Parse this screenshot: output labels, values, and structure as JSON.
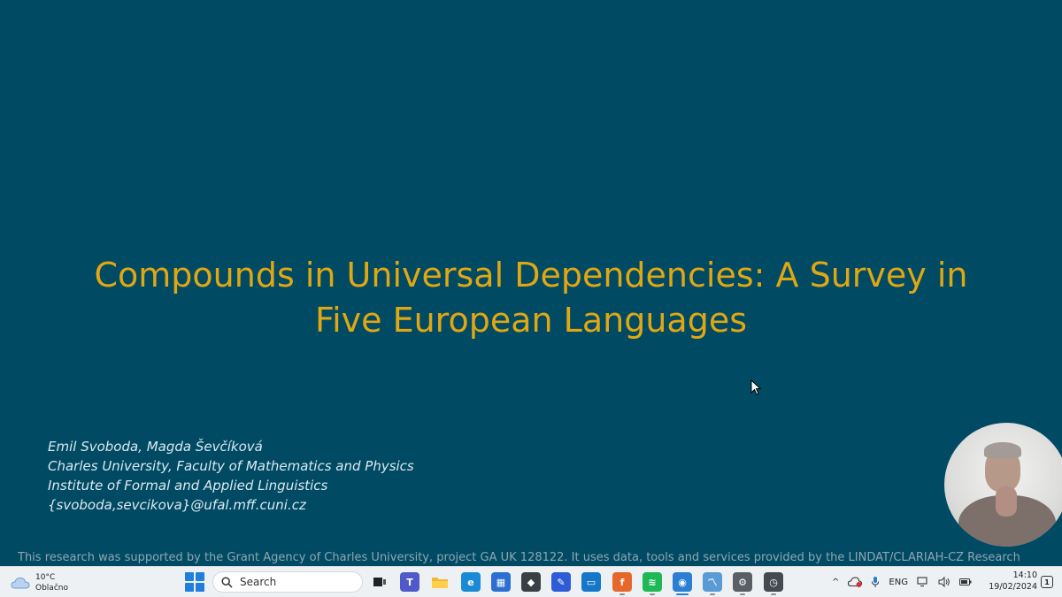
{
  "slide": {
    "title_lines": [
      "Compounds in Universal Dependencies: A Survey in",
      "Five European Languages"
    ],
    "authors": [
      "Emil Svoboda, Magda Ševčíková",
      "Charles University, Faculty of Mathematics and Physics",
      "Institute of Formal and Applied Linguistics",
      "{svoboda,sevcikova}@ufal.mff.cuni.cz"
    ],
    "footnote": "This research was supported by the Grant Agency of Charles University, project GA UK 128122. It uses data, tools and services provided by the LINDAT/CLARIAH-CZ Research"
  },
  "taskbar": {
    "weather": {
      "temperature": "10°C",
      "condition": "Oblačno",
      "icon": "cloud-icon"
    },
    "search": {
      "label": "Search"
    },
    "apps": [
      {
        "name": "task-view",
        "glyph": "",
        "color": "#222222"
      },
      {
        "name": "teams",
        "glyph": "T",
        "color": "#5059c9"
      },
      {
        "name": "file-explorer",
        "glyph": "",
        "color": "#f2b636"
      },
      {
        "name": "edge",
        "glyph": "e",
        "color": "#1a8ad6"
      },
      {
        "name": "microsoft-store",
        "glyph": "▦",
        "color": "#2a6fd1"
      },
      {
        "name": "app-dark-cube",
        "glyph": "◆",
        "color": "#3a3f45"
      },
      {
        "name": "app-blue-pen",
        "glyph": "✎",
        "color": "#2f5bd6"
      },
      {
        "name": "app-blue-monitor",
        "glyph": "▭",
        "color": "#1676c8"
      },
      {
        "name": "firefox",
        "glyph": "f",
        "color": "#e5672a"
      },
      {
        "name": "spotify",
        "glyph": "≋",
        "color": "#1db954"
      },
      {
        "name": "app-blue-circle",
        "glyph": "◉",
        "color": "#2b7fd3"
      },
      {
        "name": "app-chart",
        "glyph": "〽",
        "color": "#5b9bd5"
      },
      {
        "name": "settings",
        "glyph": "⚙",
        "color": "#5a5f66"
      },
      {
        "name": "clock-app",
        "glyph": "◷",
        "color": "#444a50"
      }
    ],
    "tray": {
      "language": "ENG",
      "chevron": "^",
      "time": "14:10",
      "date": "19/02/2024"
    }
  }
}
